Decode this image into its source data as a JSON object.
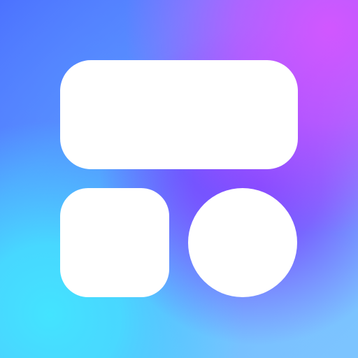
{
  "app_icon": {
    "symbol": "widget-layout-icon",
    "colors": {
      "white_shapes": "#ffffff",
      "blue_top_left": "#4b6dff",
      "purple_top_right": "#d656ff",
      "violet_center_right": "#7942ff",
      "cyan_bottom_left": "#43e4ff",
      "light_blue_bottom_right": "#7dc3ff"
    }
  }
}
